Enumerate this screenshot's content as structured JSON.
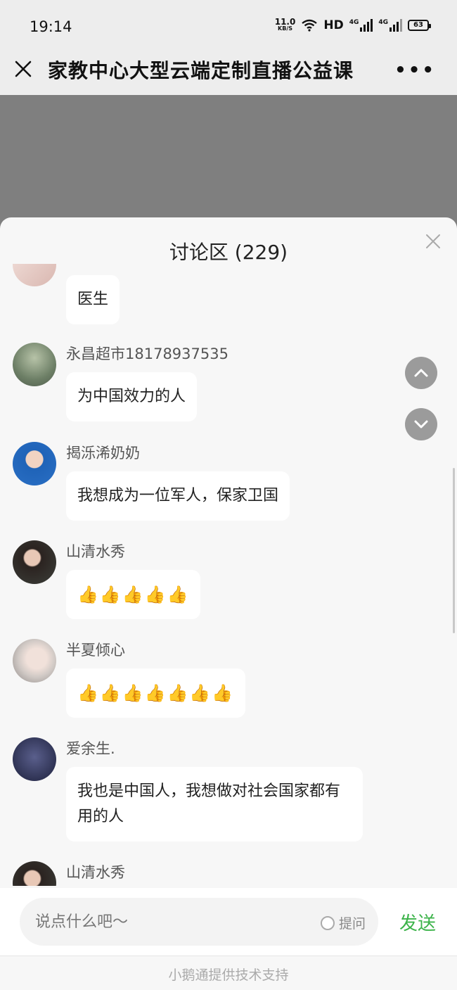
{
  "status": {
    "time": "19:14",
    "speed": "11.0",
    "speed_unit": "KB/S",
    "hd": "HD",
    "network": "4G",
    "battery": "63"
  },
  "nav": {
    "title": "家教中心大型云端定制直播公益课"
  },
  "panel": {
    "title": "讨论区 (229)"
  },
  "messages": [
    {
      "name": "",
      "text": "医生"
    },
    {
      "name": "永昌超市18178937535",
      "text": "为中国效力的人"
    },
    {
      "name": "揭泺浠奶奶",
      "text": "我想成为一位军人，保家卫国"
    },
    {
      "name": "山清水秀",
      "text": "👍👍👍👍👍"
    },
    {
      "name": "半夏倾心",
      "text": "👍👍👍👍👍👍👍"
    },
    {
      "name": "爱余生.",
      "text": "我也是中国人，我想做对社会国家都有用的人"
    },
    {
      "name": "山清水秀",
      "text": ""
    }
  ],
  "composer": {
    "placeholder": "说点什么吧～",
    "ask_label": "提问",
    "send_label": "发送"
  },
  "footer": {
    "text": "小鹅通提供技术支持"
  }
}
